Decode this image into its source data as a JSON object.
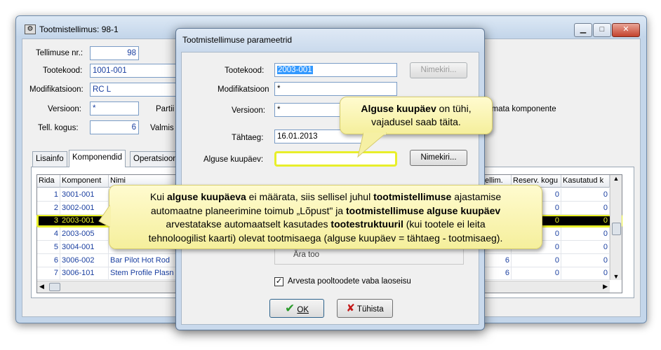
{
  "main": {
    "title": "Tootmistellimus: 98-1",
    "labels": {
      "order_nr": "Tellimuse nr.:",
      "product_code": "Tootekood:",
      "modification": "Modifikatsioon:",
      "version": "Versioon:",
      "batch": "Partii",
      "quantity": "Tell. kogus:",
      "done": "Valmis",
      "components_note": "imata komponente"
    },
    "values": {
      "order_nr": "98",
      "product_code": "1001-001",
      "modification": "RC L",
      "version": "*",
      "quantity": "6"
    },
    "tabs": [
      "Lisainfo",
      "Komponendid",
      "Operatsioon"
    ],
    "grid": {
      "headers": [
        "Rida",
        "Komponent",
        "Nimi",
        "tellim.",
        "Reserv. kogu",
        "Kasutatud k"
      ],
      "rows": [
        {
          "rida": "1",
          "komponent": "3001-001",
          "nimi": "",
          "tellim": "",
          "reserv": "0",
          "kasutatud": "0"
        },
        {
          "rida": "2",
          "komponent": "3002-001",
          "nimi": "",
          "tellim": "",
          "reserv": "0",
          "kasutatud": "0"
        },
        {
          "rida": "3",
          "komponent": "2003-001",
          "nimi": "",
          "tellim": "",
          "reserv": "0",
          "kasutatud": "0"
        },
        {
          "rida": "4",
          "komponent": "2003-005",
          "nimi": "",
          "tellim": "",
          "reserv": "0",
          "kasutatud": "0"
        },
        {
          "rida": "5",
          "komponent": "3004-001",
          "nimi": "",
          "tellim": "",
          "reserv": "0",
          "kasutatud": "0"
        },
        {
          "rida": "6",
          "komponent": "3006-002",
          "nimi": "Bar Pilot Hot Rod",
          "tellim": "6",
          "reserv": "0",
          "kasutatud": "0"
        },
        {
          "rida": "7",
          "komponent": "3006-101",
          "nimi": "Stem Profile Plasn",
          "tellim": "6",
          "reserv": "0",
          "kasutatud": "0"
        }
      ]
    }
  },
  "dialog": {
    "title": "Tootmistellimuse parameetrid",
    "labels": {
      "product_code": "Tootekood:",
      "modification": "Modifikatsioon",
      "version": "Versioon:",
      "due_date": "Tähtaeg:",
      "start_date": "Alguse kuupäev:"
    },
    "values": {
      "product_code": "2003-001",
      "modification": "*",
      "version": "*",
      "due_date": "16.01.2013",
      "start_date": ""
    },
    "buttons": {
      "list1": "Nimekiri...",
      "list3": "Nimekiri...",
      "ok": "OK",
      "cancel": "Tühista"
    },
    "radio_partial": "Ära too",
    "checkbox_label": "Arvesta pooltoodete vaba laoseisu",
    "checkbox_checked": true
  },
  "callouts": {
    "top": {
      "bold1": "Alguse kuupäev",
      "text1": " on tühi,",
      "line2": "vajadusel saab täita."
    },
    "bottom": {
      "p1": "Kui ",
      "b1": "alguse kuupäeva",
      "p2": " ei määrata, siis sellisel juhul ",
      "b2": "tootmistellimuse",
      "p3": " ajastamise",
      "p4": "automaatne planeerimine toimub „Lõpust\" ja ",
      "b3": "tootmistellimuse alguse kuupäev",
      "p5": "arvestatakse automaatselt kasutades ",
      "b4": "tootestruktuuril",
      "p6": " (kui tootele ei leita",
      "p7": "tehnoloogilist kaarti) olevat tootmisaega (alguse kuupäev = tähtaeg - tootmisaeg)."
    }
  },
  "colors": {
    "highlight": "#e8ef2a",
    "link_blue": "#1a3fa0",
    "callout_bg": "#fffbcf"
  }
}
